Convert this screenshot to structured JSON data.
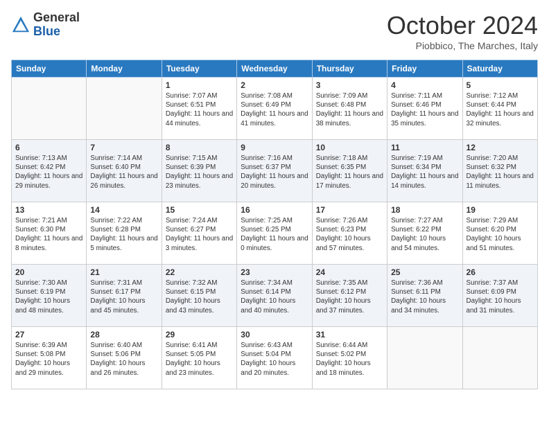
{
  "logo": {
    "general": "General",
    "blue": "Blue"
  },
  "header": {
    "month": "October 2024",
    "location": "Piobbico, The Marches, Italy"
  },
  "weekdays": [
    "Sunday",
    "Monday",
    "Tuesday",
    "Wednesday",
    "Thursday",
    "Friday",
    "Saturday"
  ],
  "weeks": [
    [
      {
        "day": null
      },
      {
        "day": null
      },
      {
        "day": "1",
        "sunrise": "Sunrise: 7:07 AM",
        "sunset": "Sunset: 6:51 PM",
        "daylight": "Daylight: 11 hours and 44 minutes."
      },
      {
        "day": "2",
        "sunrise": "Sunrise: 7:08 AM",
        "sunset": "Sunset: 6:49 PM",
        "daylight": "Daylight: 11 hours and 41 minutes."
      },
      {
        "day": "3",
        "sunrise": "Sunrise: 7:09 AM",
        "sunset": "Sunset: 6:48 PM",
        "daylight": "Daylight: 11 hours and 38 minutes."
      },
      {
        "day": "4",
        "sunrise": "Sunrise: 7:11 AM",
        "sunset": "Sunset: 6:46 PM",
        "daylight": "Daylight: 11 hours and 35 minutes."
      },
      {
        "day": "5",
        "sunrise": "Sunrise: 7:12 AM",
        "sunset": "Sunset: 6:44 PM",
        "daylight": "Daylight: 11 hours and 32 minutes."
      }
    ],
    [
      {
        "day": "6",
        "sunrise": "Sunrise: 7:13 AM",
        "sunset": "Sunset: 6:42 PM",
        "daylight": "Daylight: 11 hours and 29 minutes."
      },
      {
        "day": "7",
        "sunrise": "Sunrise: 7:14 AM",
        "sunset": "Sunset: 6:40 PM",
        "daylight": "Daylight: 11 hours and 26 minutes."
      },
      {
        "day": "8",
        "sunrise": "Sunrise: 7:15 AM",
        "sunset": "Sunset: 6:39 PM",
        "daylight": "Daylight: 11 hours and 23 minutes."
      },
      {
        "day": "9",
        "sunrise": "Sunrise: 7:16 AM",
        "sunset": "Sunset: 6:37 PM",
        "daylight": "Daylight: 11 hours and 20 minutes."
      },
      {
        "day": "10",
        "sunrise": "Sunrise: 7:18 AM",
        "sunset": "Sunset: 6:35 PM",
        "daylight": "Daylight: 11 hours and 17 minutes."
      },
      {
        "day": "11",
        "sunrise": "Sunrise: 7:19 AM",
        "sunset": "Sunset: 6:34 PM",
        "daylight": "Daylight: 11 hours and 14 minutes."
      },
      {
        "day": "12",
        "sunrise": "Sunrise: 7:20 AM",
        "sunset": "Sunset: 6:32 PM",
        "daylight": "Daylight: 11 hours and 11 minutes."
      }
    ],
    [
      {
        "day": "13",
        "sunrise": "Sunrise: 7:21 AM",
        "sunset": "Sunset: 6:30 PM",
        "daylight": "Daylight: 11 hours and 8 minutes."
      },
      {
        "day": "14",
        "sunrise": "Sunrise: 7:22 AM",
        "sunset": "Sunset: 6:28 PM",
        "daylight": "Daylight: 11 hours and 5 minutes."
      },
      {
        "day": "15",
        "sunrise": "Sunrise: 7:24 AM",
        "sunset": "Sunset: 6:27 PM",
        "daylight": "Daylight: 11 hours and 3 minutes."
      },
      {
        "day": "16",
        "sunrise": "Sunrise: 7:25 AM",
        "sunset": "Sunset: 6:25 PM",
        "daylight": "Daylight: 11 hours and 0 minutes."
      },
      {
        "day": "17",
        "sunrise": "Sunrise: 7:26 AM",
        "sunset": "Sunset: 6:23 PM",
        "daylight": "Daylight: 10 hours and 57 minutes."
      },
      {
        "day": "18",
        "sunrise": "Sunrise: 7:27 AM",
        "sunset": "Sunset: 6:22 PM",
        "daylight": "Daylight: 10 hours and 54 minutes."
      },
      {
        "day": "19",
        "sunrise": "Sunrise: 7:29 AM",
        "sunset": "Sunset: 6:20 PM",
        "daylight": "Daylight: 10 hours and 51 minutes."
      }
    ],
    [
      {
        "day": "20",
        "sunrise": "Sunrise: 7:30 AM",
        "sunset": "Sunset: 6:19 PM",
        "daylight": "Daylight: 10 hours and 48 minutes."
      },
      {
        "day": "21",
        "sunrise": "Sunrise: 7:31 AM",
        "sunset": "Sunset: 6:17 PM",
        "daylight": "Daylight: 10 hours and 45 minutes."
      },
      {
        "day": "22",
        "sunrise": "Sunrise: 7:32 AM",
        "sunset": "Sunset: 6:15 PM",
        "daylight": "Daylight: 10 hours and 43 minutes."
      },
      {
        "day": "23",
        "sunrise": "Sunrise: 7:34 AM",
        "sunset": "Sunset: 6:14 PM",
        "daylight": "Daylight: 10 hours and 40 minutes."
      },
      {
        "day": "24",
        "sunrise": "Sunrise: 7:35 AM",
        "sunset": "Sunset: 6:12 PM",
        "daylight": "Daylight: 10 hours and 37 minutes."
      },
      {
        "day": "25",
        "sunrise": "Sunrise: 7:36 AM",
        "sunset": "Sunset: 6:11 PM",
        "daylight": "Daylight: 10 hours and 34 minutes."
      },
      {
        "day": "26",
        "sunrise": "Sunrise: 7:37 AM",
        "sunset": "Sunset: 6:09 PM",
        "daylight": "Daylight: 10 hours and 31 minutes."
      }
    ],
    [
      {
        "day": "27",
        "sunrise": "Sunrise: 6:39 AM",
        "sunset": "Sunset: 5:08 PM",
        "daylight": "Daylight: 10 hours and 29 minutes."
      },
      {
        "day": "28",
        "sunrise": "Sunrise: 6:40 AM",
        "sunset": "Sunset: 5:06 PM",
        "daylight": "Daylight: 10 hours and 26 minutes."
      },
      {
        "day": "29",
        "sunrise": "Sunrise: 6:41 AM",
        "sunset": "Sunset: 5:05 PM",
        "daylight": "Daylight: 10 hours and 23 minutes."
      },
      {
        "day": "30",
        "sunrise": "Sunrise: 6:43 AM",
        "sunset": "Sunset: 5:04 PM",
        "daylight": "Daylight: 10 hours and 20 minutes."
      },
      {
        "day": "31",
        "sunrise": "Sunrise: 6:44 AM",
        "sunset": "Sunset: 5:02 PM",
        "daylight": "Daylight: 10 hours and 18 minutes."
      },
      {
        "day": null
      },
      {
        "day": null
      }
    ]
  ]
}
